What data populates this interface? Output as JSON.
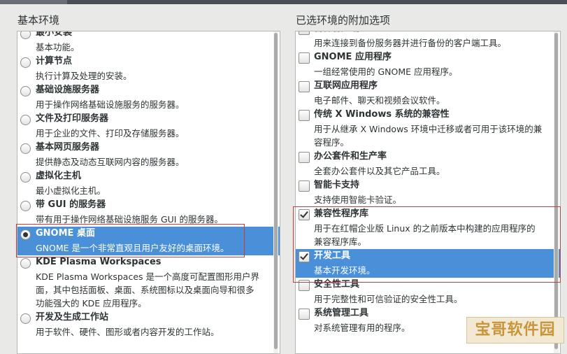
{
  "left_title": "基本环境",
  "right_title": "已选环境的附加选项",
  "environments": [
    {
      "title": "最小安装",
      "desc": [
        "基本功能。"
      ],
      "selected": false
    },
    {
      "title": "计算节点",
      "desc": [
        "执行计算及处理的安装。"
      ],
      "selected": false
    },
    {
      "title": "基础设施服务器",
      "desc": [
        "用于操作网络基础设施服务的服务器。"
      ],
      "selected": false
    },
    {
      "title": "文件及打印服务器",
      "desc": [
        "用于企业的文件、打印及存储服务器。"
      ],
      "selected": false
    },
    {
      "title": "基本网页服务器",
      "desc": [
        "提供静态及动态互联网内容的服务器。"
      ],
      "selected": false
    },
    {
      "title": "虚拟化主机",
      "desc": [
        "最小虚拟化主机。"
      ],
      "selected": false
    },
    {
      "title": "带 GUI 的服务器",
      "desc": [
        "带有用于操作网络基础设施服务 GUI 的服务器。"
      ],
      "selected": false
    },
    {
      "title": "GNOME 桌面",
      "desc": [
        "GNOME 是一个非常直观且用户友好的桌面环境。"
      ],
      "selected": true
    },
    {
      "title": "KDE Plasma Workspaces",
      "desc": [
        "KDE Plasma Workspaces 是一个高度可配置图形用户界",
        "面，其中包括面板、桌面、系统图标以及桌面向导和很多",
        "功能强大的 KDE 应用程序。"
      ],
      "selected": false
    },
    {
      "title": "开发及生成工作站",
      "desc": [
        "用于软件、硬件、图形或者内容开发的工作站。"
      ],
      "selected": false
    }
  ],
  "addons": [
    {
      "title": "备份客户端",
      "desc": [
        "用来连接到备份服务器并进行备份的客户端工具。"
      ],
      "checked": false
    },
    {
      "title": "GNOME 应用程序",
      "desc": [
        "一组经常使用的 GNOME 应用程序。"
      ],
      "checked": false
    },
    {
      "title": "互联网应用程序",
      "desc": [
        "电子邮件、聊天和视频会议软件。"
      ],
      "checked": false
    },
    {
      "title": "传统 X Windows 系统的兼容性",
      "desc": [
        "用于从继承 X Windows 环境中迁移或者可用于该环境的兼",
        "容程序。"
      ],
      "checked": false
    },
    {
      "title": "办公套件和生产率",
      "desc": [
        "全套办公套件以及其它产品工具。"
      ],
      "checked": false
    },
    {
      "title": "智能卡支持",
      "desc": [
        "支持使用智能卡验证。"
      ],
      "checked": false
    },
    {
      "title": "兼容性程序库",
      "desc": [
        "用于在红帽企业版 Linux 的之前版本中构建的应用程序的",
        "兼容程序库。"
      ],
      "checked": true
    },
    {
      "title": "开发工具",
      "desc": [
        "基本开发环境。"
      ],
      "checked": true,
      "highlighted": true
    },
    {
      "title": "安全性工具",
      "desc": [
        "用于完整性和可信验证的安全性工具。"
      ],
      "checked": false
    },
    {
      "title": "系统管理工具",
      "desc": [
        "对系统管理有用的程序。"
      ],
      "checked": false
    }
  ],
  "watermark": "宝哥软件园",
  "colors": {
    "selection": "#4a90d9",
    "annotation_box": "#d03a3a"
  }
}
